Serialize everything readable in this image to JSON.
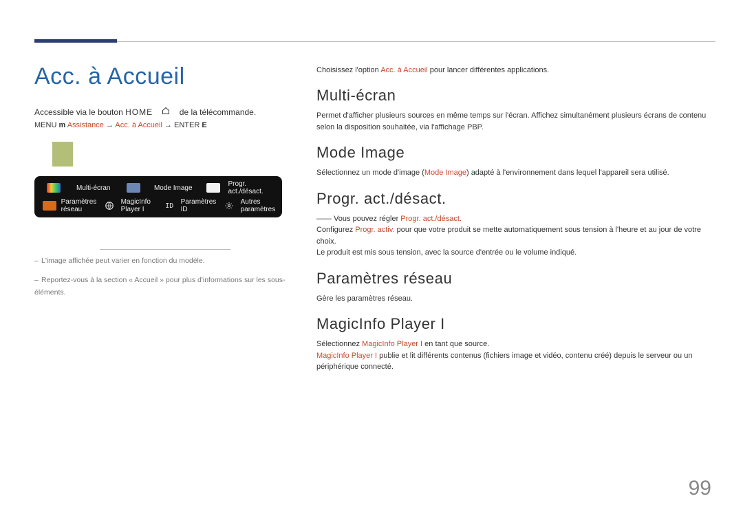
{
  "page_number": "99",
  "title": "Acc. à Accueil",
  "home_line": {
    "prefix": "Accessible via le bouton",
    "btn": "HOME",
    "suffix": "de la télécommande."
  },
  "nav": {
    "menu": "MENU",
    "m": "m",
    "assistance": "Assistance",
    "arrow1": "→",
    "acc": "Acc. à Accueil",
    "arrow2": "→",
    "enter": "ENTER",
    "e": "E"
  },
  "appbar": {
    "row1_labels": [
      "Multi-écran",
      "Mode Image",
      "Progr. act./désact."
    ],
    "row2_labels": [
      "Paramètres réseau",
      "MagicInfo Player I",
      "Paramètres ID",
      "Autres paramètres"
    ]
  },
  "footnotes": {
    "a": "L'image affichée peut varier en fonction du modèle.",
    "b": "Reportez-vous à la section « Accueil » pour plus d'informations sur les sous-éléments."
  },
  "intro": {
    "pre": "Choisissez l'option ",
    "hl": "Acc. à Accueil",
    "post": " pour lancer différentes applications."
  },
  "sections": {
    "multi_ecran": {
      "h": "Multi-écran",
      "body": "Permet d'afficher plusieurs sources en même temps sur l'écran. Affichez simultanément plusieurs écrans de contenu selon la disposition souhaitée, via l'affichage PBP."
    },
    "mode_image": {
      "h": "Mode Image",
      "body_pre": "Sélectionnez un mode d'image (",
      "body_hl": "Mode Image",
      "body_post": ") adapté à l'environnement dans lequel l'appareil sera utilisé."
    },
    "progr": {
      "h": "Progr. act./désact.",
      "l1_pre": "Vous pouvez régler ",
      "l1_hl": "Progr. act./désact.",
      "l1_post": "",
      "l2_pre": "Configurez ",
      "l2_hl": "Progr. activ.",
      "l2_post": " pour que votre produit se mette automatiquement sous tension à l'heure et au jour de votre choix.",
      "l3": "Le produit est mis sous tension, avec la source d'entrée ou le volume indiqué."
    },
    "reseau": {
      "h": "Paramètres réseau",
      "body": "Gère les paramètres réseau."
    },
    "magicinfo": {
      "h": "MagicInfo Player I",
      "l1_pre": "Sélectionnez ",
      "l1_hl": "MagicInfo Player I",
      "l1_post": " en tant que source.",
      "l2_hl": "MagicInfo Player I",
      "l2_post": " publie et lit différents contenus (fichiers image et vidéo, contenu créé) depuis le serveur ou un périphérique connecté."
    }
  }
}
